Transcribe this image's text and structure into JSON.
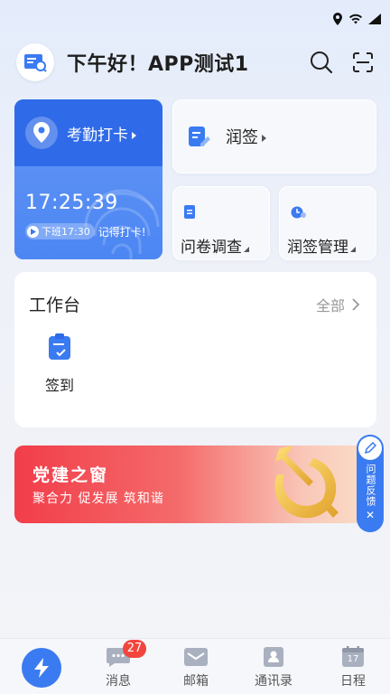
{
  "header": {
    "greeting": "下午好！APP测试1"
  },
  "attendance": {
    "title": "考勤打卡",
    "time": "17:25:39",
    "off_work": "下班17:30",
    "reminder": "记得打卡!"
  },
  "quick_cards": {
    "runqian": "润签",
    "survey": "问卷调查",
    "runqian_manage": "润签管理"
  },
  "workbench": {
    "title": "工作台",
    "all_label": "全部",
    "items": [
      {
        "label": "签到"
      }
    ]
  },
  "banner": {
    "title": "党建之窗",
    "subtitle": "聚合力 促发展 筑和谐"
  },
  "feedback": {
    "label": "问题反馈"
  },
  "tabbar": {
    "messages": "消息",
    "messages_badge": "27",
    "mail": "邮箱",
    "contacts": "通讯录",
    "calendar": "日程",
    "calendar_day": "17"
  },
  "colors": {
    "primary": "#3b7bf1",
    "badge": "#f2453d",
    "banner_red": "#f23d4a"
  }
}
